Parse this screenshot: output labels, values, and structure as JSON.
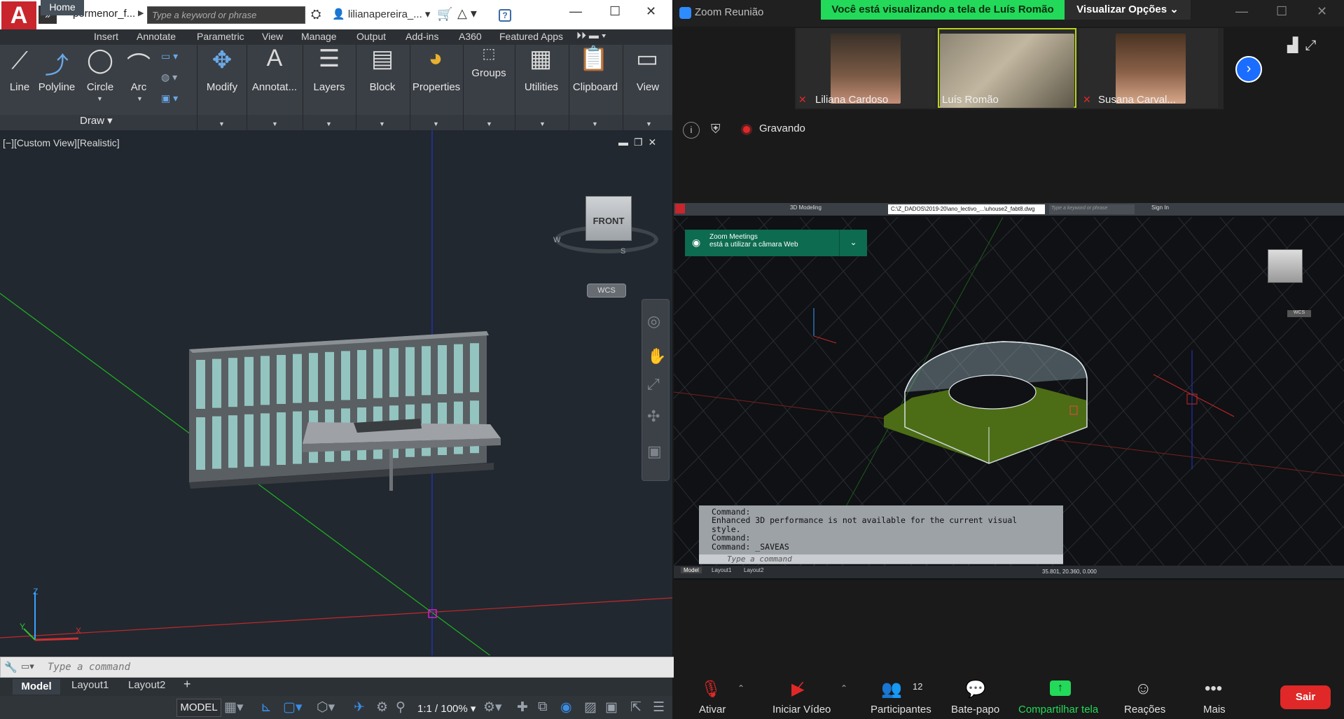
{
  "autocad": {
    "filename": "pormenor_f...",
    "search_placeholder": "Type a keyword or phrase",
    "user": "lilianapereira_...",
    "tabs": [
      "Home",
      "Insert",
      "Annotate",
      "Parametric",
      "View",
      "Manage",
      "Output",
      "Add-ins",
      "A360",
      "Featured Apps"
    ],
    "draw_tools": [
      "Line",
      "Polyline",
      "Circle",
      "Arc"
    ],
    "draw_panel": "Draw",
    "panels": [
      "Modify",
      "Annotat...",
      "Layers",
      "Block",
      "Properties",
      "Groups",
      "Utilities",
      "Clipboard",
      "View"
    ],
    "viewport_label": "[−][Custom View][Realistic]",
    "viewcube_face": "FRONT",
    "viewcube_w": "W",
    "viewcube_s": "S",
    "wcs": "WCS",
    "cmd_placeholder": "Type a command",
    "layout_tabs": [
      "Model",
      "Layout1",
      "Layout2"
    ],
    "status_model": "MODEL",
    "status_scale": "1:1 / 100%",
    "axis_z": "Z",
    "axis_y": "Y",
    "axis_x": "X"
  },
  "zoom": {
    "window_title": "Zoom Reunião",
    "share_banner": "Você está visualizando a tela de Luís Romão",
    "view_options": "Visualizar Opções",
    "participants": [
      {
        "name": "Liliana Cardoso",
        "muted": true
      },
      {
        "name": "Luís Romão",
        "muted": false
      },
      {
        "name": "Susana Carval...",
        "muted": true
      }
    ],
    "recording": "Gravando",
    "toolbar": {
      "mute": "Ativar",
      "video": "Iniciar Vídeo",
      "participants": "Participantes",
      "participants_count": "12",
      "chat": "Bate-papo",
      "share": "Compartilhar tela",
      "reactions": "Reações",
      "more": "Mais",
      "leave": "Sair"
    },
    "colors": {
      "share_green": "#23d959",
      "leave_red": "#e02828",
      "accent_blue": "#1a6dff"
    }
  },
  "shared_screen": {
    "workspace": "3D Modeling",
    "tab_title": "C:\\Z_DADOS\\2019-20\\ano_lectivo_...\\uhouse2_fabt8.dwg",
    "search_placeholder": "Type a keyword or phrase",
    "user": "Sign In",
    "toast_title": "Zoom Meetings",
    "toast_text": "está a utilizar a câmara Web",
    "command_history": "Command:\nEnhanced 3D performance is not available for the current visual\nstyle.\nCommand:\nCommand: _SAVEAS",
    "cmd_placeholder": "Type a command",
    "layout_tabs": [
      "Model",
      "Layout1",
      "Layout2"
    ],
    "coords": "35.801, 20.360, 0.000",
    "wcs": "WCS"
  }
}
